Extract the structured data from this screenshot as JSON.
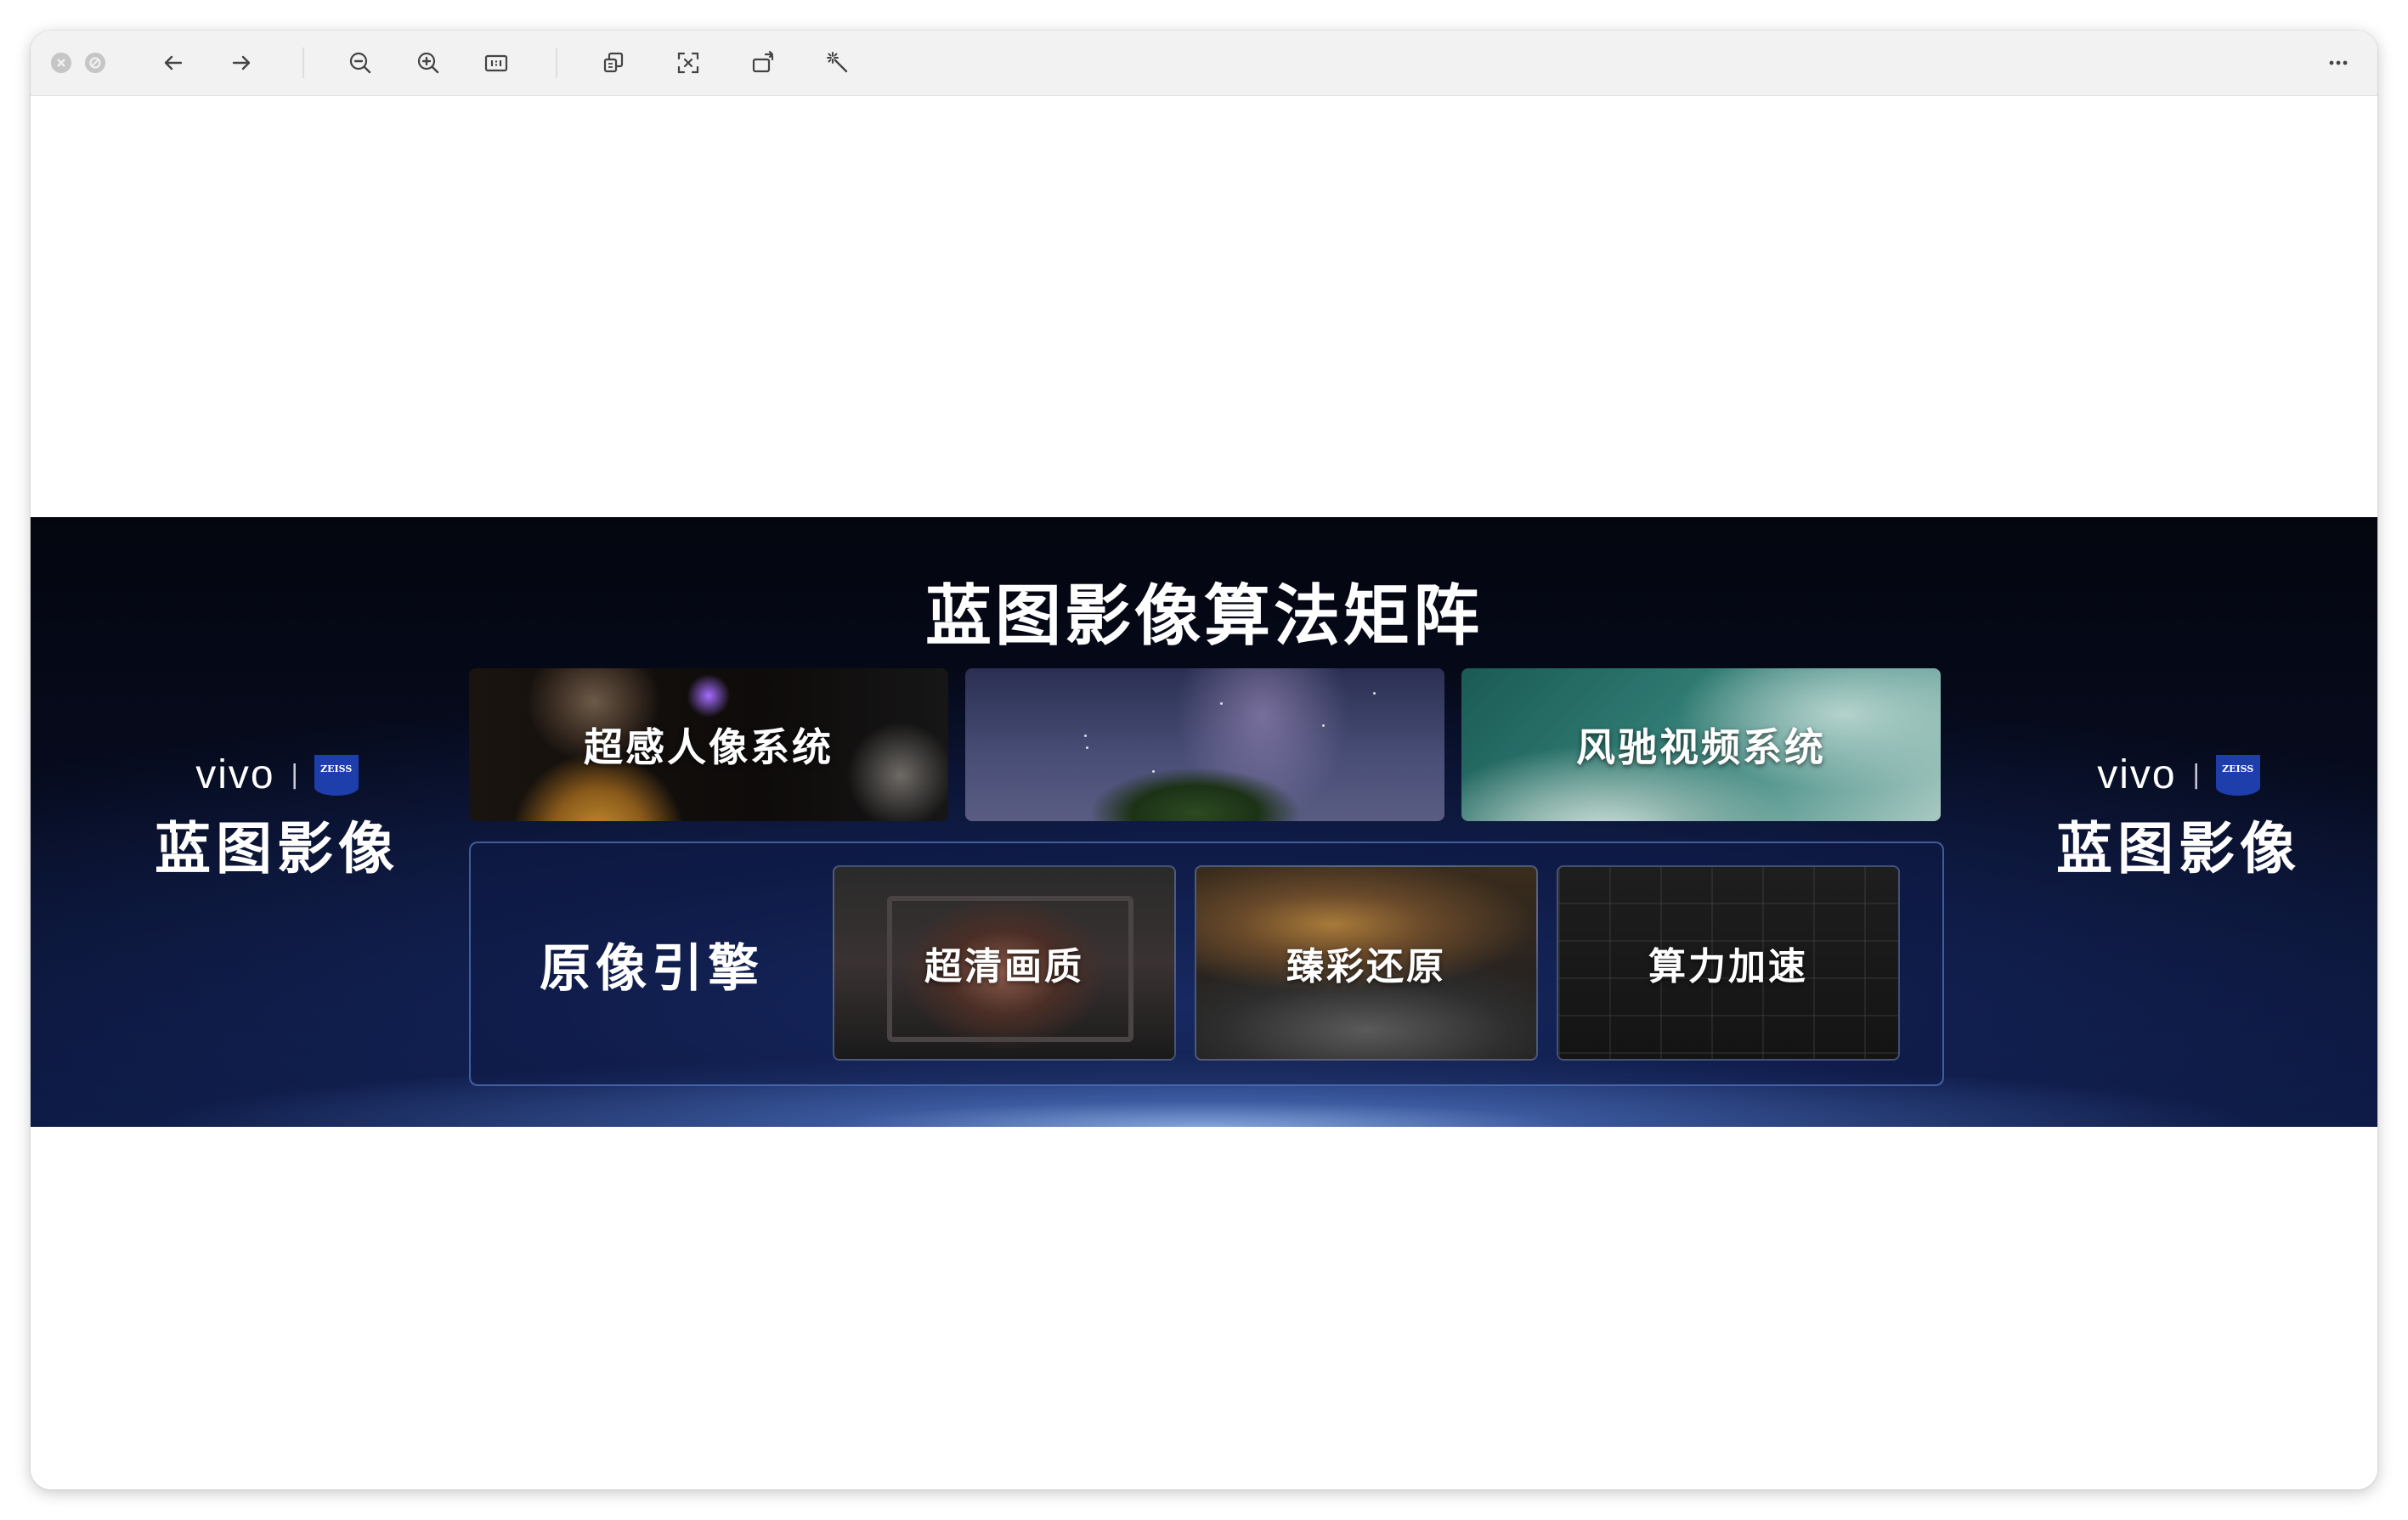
{
  "toolbar": {
    "buttons": [
      {
        "name": "close-button",
        "icon": "close-icon"
      },
      {
        "name": "minimize-button",
        "icon": "minimize-icon"
      },
      {
        "name": "back-button",
        "icon": "arrow-left-icon"
      },
      {
        "name": "forward-button",
        "icon": "arrow-right-icon"
      },
      {
        "name": "zoom-out-button",
        "icon": "zoom-out-icon"
      },
      {
        "name": "zoom-in-button",
        "icon": "zoom-in-icon"
      },
      {
        "name": "actual-size-button",
        "icon": "actual-size-icon"
      },
      {
        "name": "copy-button",
        "icon": "copy-icon"
      },
      {
        "name": "crop-button",
        "icon": "crop-icon"
      },
      {
        "name": "rotate-button",
        "icon": "rotate-icon"
      },
      {
        "name": "magic-wand-button",
        "icon": "magic-wand-icon"
      },
      {
        "name": "more-button",
        "icon": "more-horizontal-icon"
      }
    ]
  },
  "slide": {
    "title": "蓝图影像算法矩阵",
    "brand_left": {
      "logo": "vivo",
      "divider": "|",
      "zeiss": "ZEISS",
      "name": "蓝图影像"
    },
    "brand_right": {
      "logo": "vivo",
      "divider": "|",
      "zeiss": "ZEISS",
      "name": "蓝图影像"
    },
    "top_cards": [
      {
        "label": "超感人像系统"
      },
      {
        "label": ""
      },
      {
        "label": "风驰视频系统"
      }
    ],
    "engine": {
      "label": "原像引擎",
      "sub_cards": [
        {
          "label": "超清画质"
        },
        {
          "label": "臻彩还原"
        },
        {
          "label": "算力加速"
        }
      ]
    }
  },
  "colors": {
    "toolbar_bg": "#f2f2f2",
    "slide_bg_dark": "#04060f",
    "slide_glow": "#96b9f0",
    "zeiss_blue": "#1d3eab"
  }
}
